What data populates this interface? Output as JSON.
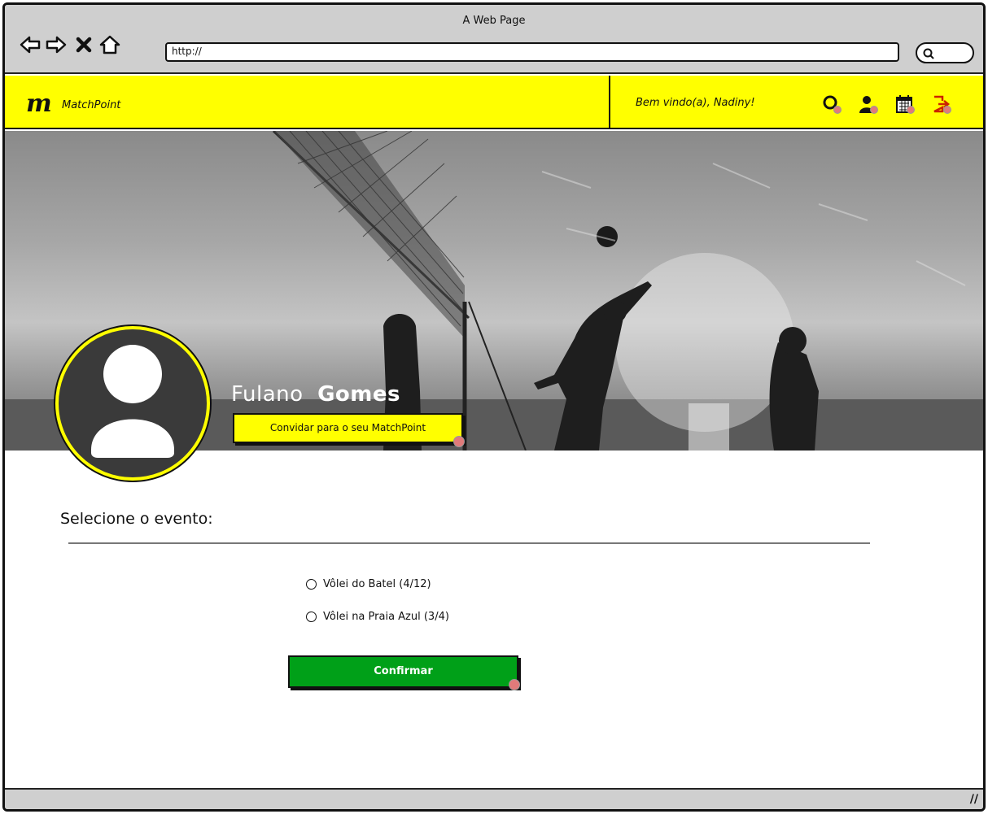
{
  "browser": {
    "window_title": "A Web Page",
    "url": "http://"
  },
  "header": {
    "logo_mark": "m",
    "logo_text": "MatchPoint",
    "welcome": "Bem vindo(a), Nadiny!",
    "icons": [
      "search-icon",
      "user-icon",
      "calendar-icon",
      "logout-icon"
    ],
    "accent_color": "#ffff00"
  },
  "profile": {
    "first_name": "Fulano",
    "last_name": "Gomes",
    "invite_label": "Convidar para o seu MatchPoint"
  },
  "events": {
    "title": "Selecione o evento:",
    "options": [
      {
        "label": "Vôlei do Batel (4/12)",
        "selected": false
      },
      {
        "label": "Vôlei na Praia Azul (3/4)",
        "selected": false
      }
    ],
    "confirm_label": "Confirmar",
    "confirm_color": "#00a018"
  }
}
